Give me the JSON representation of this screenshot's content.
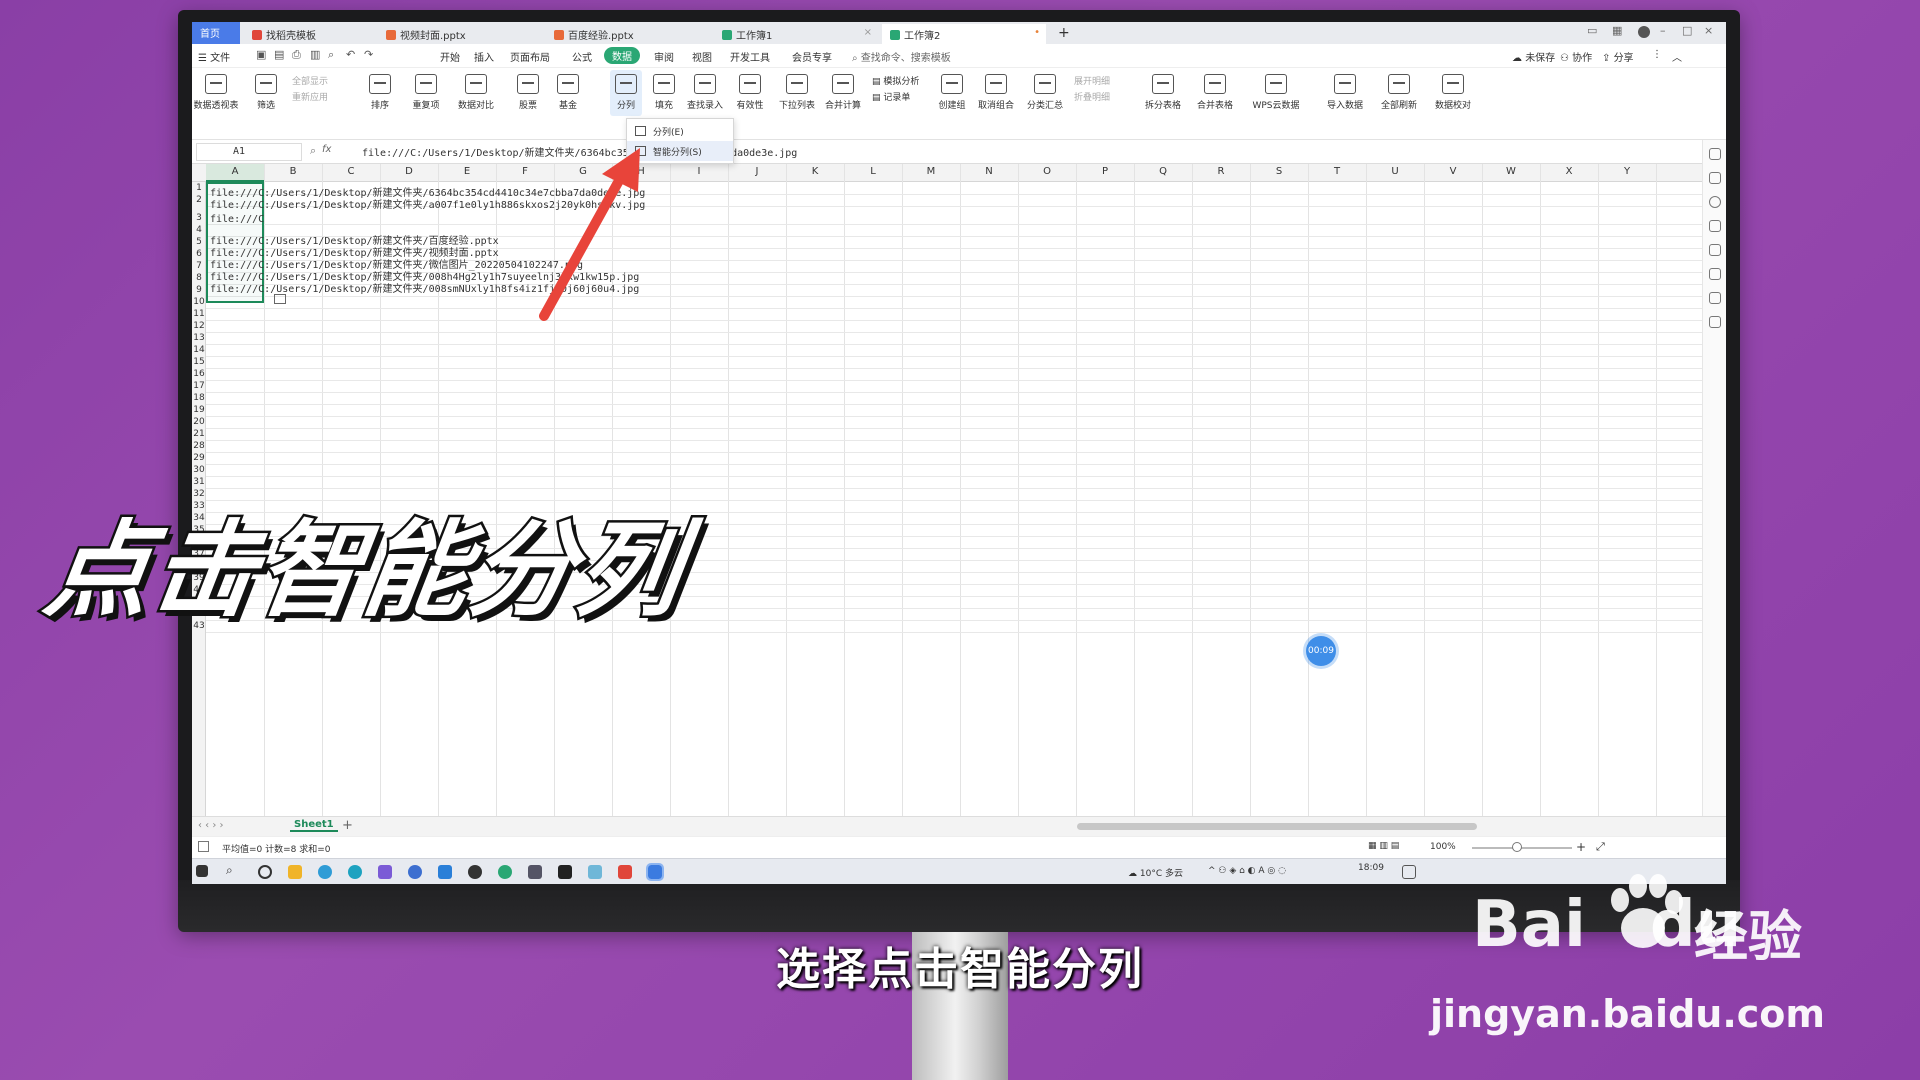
{
  "tabs": [
    {
      "label": "首页"
    },
    {
      "label": "找稻壳模板"
    },
    {
      "label": "视频封面.pptx"
    },
    {
      "label": "百度经验.pptx"
    },
    {
      "label": "工作簿1"
    },
    {
      "label": "工作簿2"
    }
  ],
  "menu": {
    "file": "文件",
    "items": [
      "开始",
      "插入",
      "页面布局",
      "公式",
      "数据",
      "审阅",
      "视图",
      "开发工具",
      "会员专享"
    ],
    "active": "数据",
    "search": "查找命令、搜索模板",
    "unsaved": "未保存",
    "collab": "协作",
    "share": "分享"
  },
  "ribbon": {
    "pivot": "数据透视表",
    "filter": "筛选",
    "show_all": "全部显示",
    "reapply": "重新应用",
    "sort": "排序",
    "dup": "重复项",
    "compare": "数据对比",
    "stock": "股票",
    "fund": "基金",
    "split": "分列",
    "fill": "填充",
    "lookup": "查找录入",
    "validity": "有效性",
    "dropdown_list": "下拉列表",
    "consolidate": "合并计算",
    "simulate": "模拟分析",
    "record": "记录单",
    "group": "创建组",
    "ungroup": "取消组合",
    "subtotal": "分类汇总",
    "expand": "展开明细",
    "collapse": "折叠明细",
    "split_table": "拆分表格",
    "merge_table": "合并表格",
    "wps_data": "WPS云数据",
    "import": "导入数据",
    "refresh": "全部刷新",
    "verify": "数据校对"
  },
  "dropdown": {
    "item1": "分列(E)",
    "item2": "智能分列(S)"
  },
  "formula_bar": {
    "cell": "A1",
    "fx": "fx",
    "content": "file:///C:/Users/1/Desktop/新建文件夹/6364bc354cd4410c34e7cbba7da0de3e.jpg"
  },
  "columns": [
    "A",
    "B",
    "C",
    "D",
    "E",
    "F",
    "G",
    "H",
    "I",
    "J",
    "K",
    "L",
    "M",
    "N",
    "O",
    "P",
    "Q",
    "R",
    "S",
    "T",
    "U",
    "V",
    "W",
    "X",
    "Y"
  ],
  "rows": [
    "1",
    "2",
    "3",
    "4",
    "5",
    "6",
    "7",
    "8",
    "9",
    "10",
    "11",
    "12",
    "13",
    "14",
    "15",
    "16",
    "17",
    "18",
    "19",
    "20",
    "21",
    "28",
    "29",
    "30",
    "31",
    "32",
    "33",
    "34",
    "35",
    "36",
    "37",
    "38",
    "39",
    "40",
    "41",
    "42",
    "43"
  ],
  "cells": {
    "r1": "file:///C:/Users/1/Desktop/新建文件夹/6364bc354cd4410c34e7cbba7da0de3e.jpg",
    "r2": "file:///C:/Users/1/Desktop/新建文件夹/a007f1e0ly1h886skxos2j20yk0hstkv.jpg",
    "r3": "file:///C",
    "r4": "file:///C:/Users/1/Desktop/新建文件夹/百度经验.pptx",
    "r5": "file:///C:/Users/1/Desktop/新建文件夹/视频封面.pptx",
    "r6": "file:///C:/Users/1/Desktop/新建文件夹/微信图片_20220504102247.png",
    "r7": "file:///C:/Users/1/Desktop/新建文件夹/008h4Hg2ly1h7suyeelnj31kw1kw15p.jpg",
    "r8": "file:///C:/Users/1/Desktop/新建文件夹/008smNUxly1h8fs4iz1fj30j60j60u4.jpg"
  },
  "sheet": {
    "name": "Sheet1",
    "status": "平均值=0  计数=8  求和=0",
    "zoom": "100%"
  },
  "taskbar": {
    "weather": "10°C 多云",
    "time": "18:09"
  },
  "timer": "00:09",
  "overlay": {
    "caption": "点击智能分列",
    "subtitle": "选择点击智能分列"
  },
  "watermark": {
    "logo": "Bai",
    "logo2": "du",
    "jingyan": "经验",
    "url": "jingyan.baidu.com"
  },
  "colors": {
    "accent": "#2aa774",
    "selection": "#1d8a5a",
    "arrow": "#e8443a",
    "background": "#8a3fa6"
  }
}
